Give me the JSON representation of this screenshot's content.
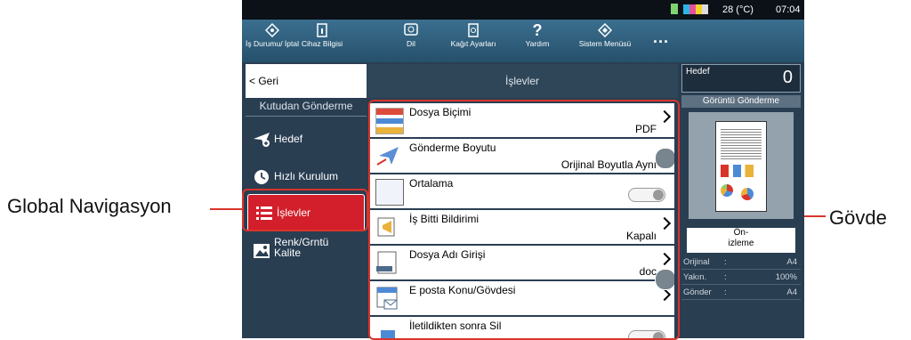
{
  "callouts": {
    "left": "Global Navigasyon",
    "right": "Gövde"
  },
  "status": {
    "temperature": "28 (°C)",
    "time": "07:04"
  },
  "toolbar": {
    "items": [
      {
        "label": "İş Durumu/ İptal"
      },
      {
        "label": "Cihaz Bilgisi"
      },
      {
        "label": "Dil"
      },
      {
        "label": "Kağıt Ayarları"
      },
      {
        "label": "Yardım"
      },
      {
        "label": "Sistem Menüsü"
      }
    ],
    "more": "..."
  },
  "left": {
    "back": "< Geri",
    "section": "Kutudan Gönderme",
    "items": [
      {
        "label": "Hedef"
      },
      {
        "label": "Hızlı Kurulum"
      },
      {
        "label": "İşlevler"
      },
      {
        "label": "Renk/Grntü Kalite"
      }
    ]
  },
  "main": {
    "header": "İşlevler",
    "rows": [
      {
        "title": "Dosya Biçimi",
        "value": "PDF"
      },
      {
        "title": "Gönderme Boyutu",
        "value": "Orijinal Boyutla Aynı"
      },
      {
        "title": "Ortalama",
        "value": ""
      },
      {
        "title": "İş Bitti Bildirimi",
        "value": "Kapalı"
      },
      {
        "title": "Dosya Adı Girişi",
        "value": "doc"
      },
      {
        "title": "E posta Konu/Gövdesi",
        "value": ""
      },
      {
        "title": "İletildikten sonra Sil",
        "value": ""
      }
    ]
  },
  "right": {
    "target_label": "Hedef",
    "target_count": "0",
    "send_title": "Görüntü Gönderme",
    "preview_btn": "Ön-\nizleme",
    "info": [
      {
        "k": "Orijinal",
        "v": "A4"
      },
      {
        "k": "Yakın.",
        "v": "100%"
      },
      {
        "k": "Gönder",
        "v": "A4"
      }
    ]
  },
  "colors": {
    "accent": "#d9342b",
    "panel": "#2a3e52",
    "selected": "#d21f2b"
  }
}
